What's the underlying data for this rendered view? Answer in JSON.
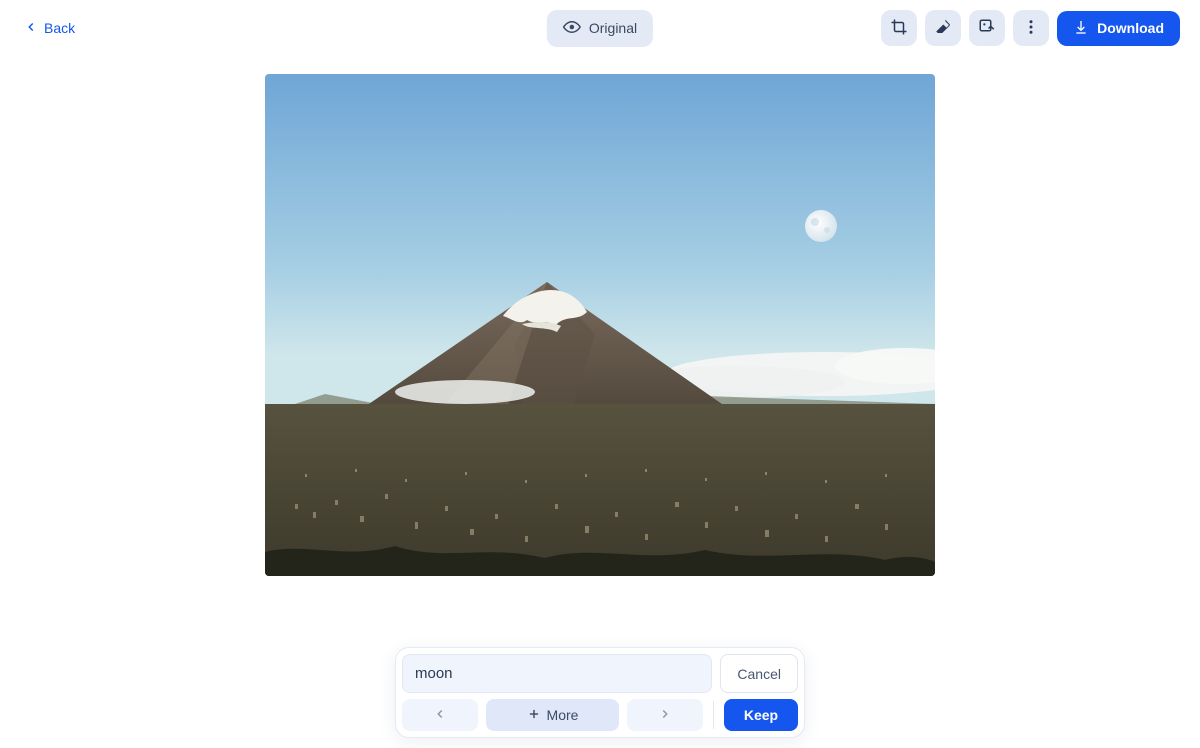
{
  "header": {
    "back_label": "Back",
    "original_label": "Original",
    "download_label": "Download",
    "tool_icons": {
      "crop": "crop-icon",
      "eraser": "eraser-icon",
      "image_edit": "image-edit-icon",
      "more": "more-vertical-icon"
    }
  },
  "panel": {
    "input_value": "moon",
    "input_placeholder": "",
    "cancel_label": "Cancel",
    "more_label": "More",
    "keep_label": "Keep"
  },
  "colors": {
    "accent": "#1556ee",
    "chip_bg": "#e3e9f5",
    "panel_input_bg": "#f0f4fc"
  }
}
